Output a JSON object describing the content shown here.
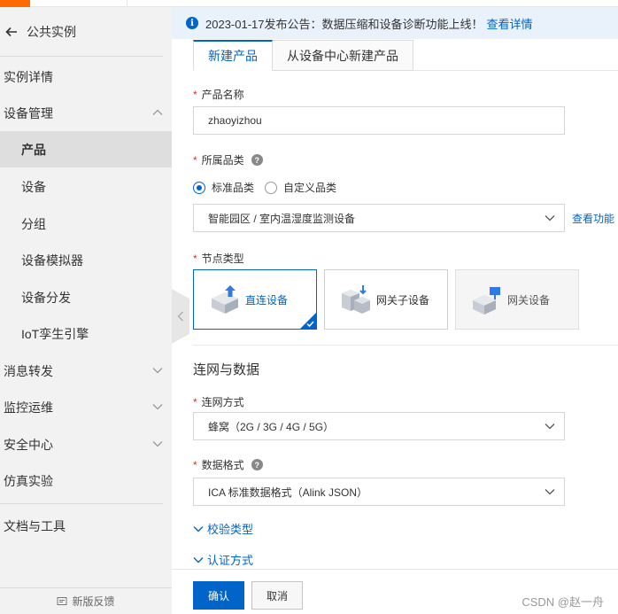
{
  "top_bar": {
    "accent_color": "#ff6a00"
  },
  "sidebar": {
    "back_label": "公共实例",
    "items": [
      {
        "label": "实例详情"
      },
      {
        "label": "设备管理"
      },
      {
        "label": "产品"
      },
      {
        "label": "设备"
      },
      {
        "label": "分组"
      },
      {
        "label": "设备模拟器"
      },
      {
        "label": "设备分发"
      },
      {
        "label": "IoT孪生引擎"
      },
      {
        "label": "消息转发"
      },
      {
        "label": "监控运维"
      },
      {
        "label": "安全中心"
      },
      {
        "label": "仿真实验"
      },
      {
        "label": "文档与工具"
      }
    ],
    "feedback_label": "新版反馈"
  },
  "notice": {
    "text": "2023-01-17发布公告：数据压缩和设备诊断功能上线！",
    "link": "查看详情"
  },
  "tabs": [
    {
      "label": "新建产品"
    },
    {
      "label": "从设备中心新建产品"
    }
  ],
  "form": {
    "required_mark": "*",
    "product_name": {
      "label": "产品名称",
      "value": "zhaoyizhou"
    },
    "category": {
      "label": "所属品类",
      "options": [
        {
          "label": "标准品类",
          "selected": true
        },
        {
          "label": "自定义品类",
          "selected": false
        }
      ],
      "value": "智能园区 / 室内温湿度监测设备",
      "side_link": "查看功能"
    },
    "node_type": {
      "label": "节点类型",
      "options": [
        {
          "label": "直连设备",
          "icon": "direct-device-icon",
          "selected": true
        },
        {
          "label": "网关子设备",
          "icon": "gateway-subdevice-icon",
          "selected": false
        },
        {
          "label": "网关设备",
          "icon": "gateway-device-icon",
          "selected": false
        }
      ]
    },
    "section_title": "连网与数据",
    "network": {
      "label": "连网方式",
      "value": "蜂窝（2G / 3G / 4G / 5G）"
    },
    "data_format": {
      "label": "数据格式",
      "value": "ICA 标准数据格式（Alink JSON）"
    },
    "collapsibles": [
      {
        "label": "校验类型"
      },
      {
        "label": "认证方式"
      }
    ]
  },
  "footer": {
    "confirm_label": "确认",
    "cancel_label": "取消",
    "watermark": "CSDN @赵一舟"
  },
  "colors": {
    "primary": "#0064c8",
    "required": "#d93026"
  }
}
